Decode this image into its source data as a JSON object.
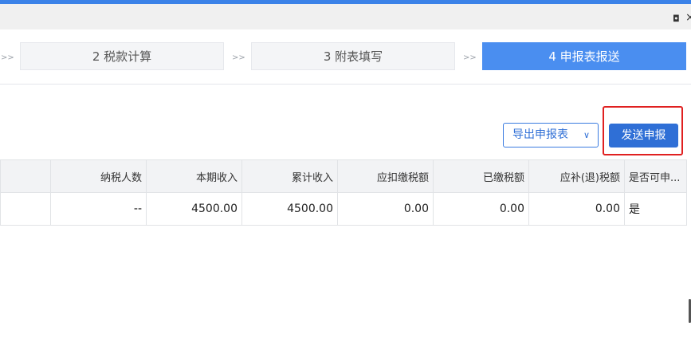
{
  "window": {
    "restore_glyph": "◘",
    "close_glyph": "×"
  },
  "steps": {
    "separator": ">>",
    "items": [
      {
        "label": "2 税款计算",
        "active": false
      },
      {
        "label": "3 附表填写",
        "active": false
      },
      {
        "label": "4 申报表报送",
        "active": true
      }
    ]
  },
  "toolbar": {
    "export_label": "导出申报表",
    "send_label": "发送申报"
  },
  "table": {
    "headers": [
      "纳税人数",
      "本期收入",
      "累计收入",
      "应扣缴税额",
      "已缴税额",
      "应补(退)税额",
      "是否可申..."
    ],
    "rows": [
      {
        "count": "--",
        "current_income": "4500.00",
        "cumulative_income": "4500.00",
        "deductible_tax": "0.00",
        "paid_tax": "0.00",
        "refund_tax": "0.00",
        "can_declare": "是"
      }
    ]
  },
  "colors": {
    "accent": "#4a8ef0",
    "highlight": "#e02020",
    "yes": "#2bb24c"
  }
}
